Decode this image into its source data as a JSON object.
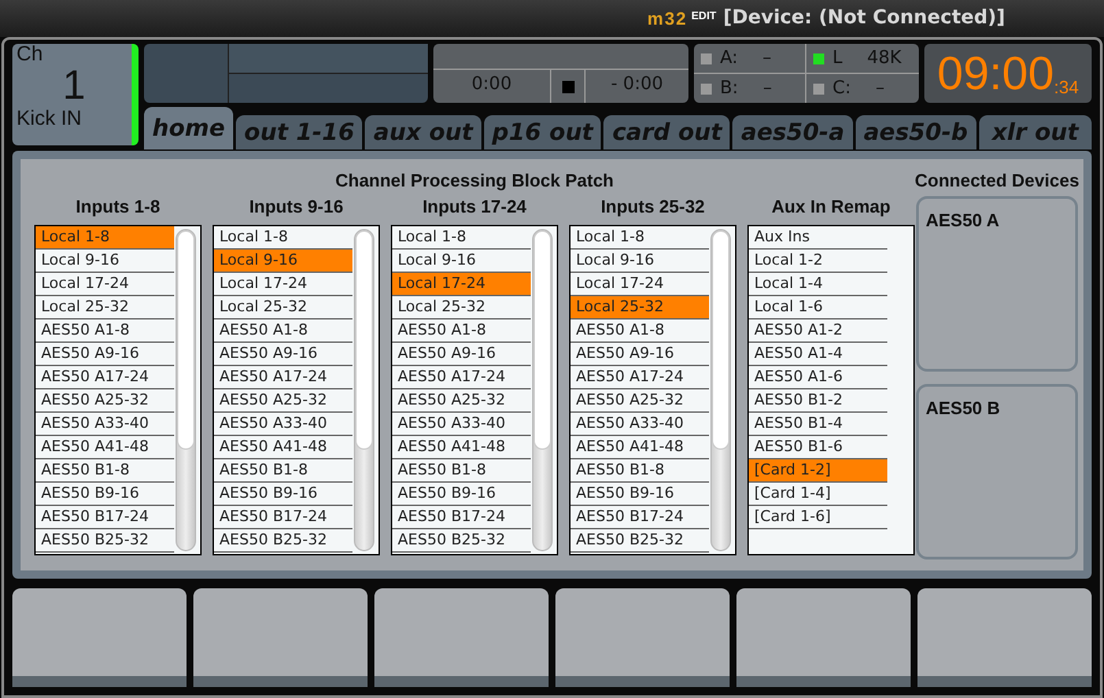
{
  "title_bar": {
    "logo_mark": "m32",
    "logo_word": "EDIT",
    "title": "[Device: (Not Connected)]"
  },
  "channel": {
    "label": "Ch",
    "number": "1",
    "name": "Kick IN"
  },
  "transport": {
    "elapsed": "0:00",
    "remaining": "- 0:00"
  },
  "status": [
    {
      "label": "A:",
      "value": "–",
      "on": false
    },
    {
      "label": "L",
      "value": "48K",
      "on": true
    },
    {
      "label": "B:",
      "value": "–",
      "on": false
    },
    {
      "label": "C:",
      "value": "–",
      "on": false
    }
  ],
  "clock": {
    "time": "09:00",
    "seconds": ":34"
  },
  "tabs": [
    {
      "label": "home",
      "selected": true
    },
    {
      "label": "out 1-16",
      "selected": false
    },
    {
      "label": "aux out",
      "selected": false
    },
    {
      "label": "p16 out",
      "selected": false
    },
    {
      "label": "card out",
      "selected": false
    },
    {
      "label": "aes50-a",
      "selected": false
    },
    {
      "label": "aes50-b",
      "selected": false
    },
    {
      "label": "xlr out",
      "selected": false
    }
  ],
  "patch": {
    "title": "Channel Processing Block Patch",
    "lists": [
      {
        "heading": "Inputs 1-8",
        "scrollbar": true,
        "items": [
          {
            "label": "Local 1-8",
            "selected": true
          },
          {
            "label": "Local 9-16",
            "selected": false
          },
          {
            "label": "Local 17-24",
            "selected": false
          },
          {
            "label": "Local 25-32",
            "selected": false
          },
          {
            "label": "AES50 A1-8",
            "selected": false
          },
          {
            "label": "AES50 A9-16",
            "selected": false
          },
          {
            "label": "AES50 A17-24",
            "selected": false
          },
          {
            "label": "AES50 A25-32",
            "selected": false
          },
          {
            "label": "AES50 A33-40",
            "selected": false
          },
          {
            "label": "AES50 A41-48",
            "selected": false
          },
          {
            "label": "AES50 B1-8",
            "selected": false
          },
          {
            "label": "AES50 B9-16",
            "selected": false
          },
          {
            "label": "AES50 B17-24",
            "selected": false
          },
          {
            "label": "AES50 B25-32",
            "selected": false
          }
        ]
      },
      {
        "heading": "Inputs 9-16",
        "scrollbar": true,
        "items": [
          {
            "label": "Local 1-8",
            "selected": false
          },
          {
            "label": "Local 9-16",
            "selected": true
          },
          {
            "label": "Local 17-24",
            "selected": false
          },
          {
            "label": "Local 25-32",
            "selected": false
          },
          {
            "label": "AES50 A1-8",
            "selected": false
          },
          {
            "label": "AES50 A9-16",
            "selected": false
          },
          {
            "label": "AES50 A17-24",
            "selected": false
          },
          {
            "label": "AES50 A25-32",
            "selected": false
          },
          {
            "label": "AES50 A33-40",
            "selected": false
          },
          {
            "label": "AES50 A41-48",
            "selected": false
          },
          {
            "label": "AES50 B1-8",
            "selected": false
          },
          {
            "label": "AES50 B9-16",
            "selected": false
          },
          {
            "label": "AES50 B17-24",
            "selected": false
          },
          {
            "label": "AES50 B25-32",
            "selected": false
          }
        ]
      },
      {
        "heading": "Inputs 17-24",
        "scrollbar": true,
        "items": [
          {
            "label": "Local 1-8",
            "selected": false
          },
          {
            "label": "Local 9-16",
            "selected": false
          },
          {
            "label": "Local 17-24",
            "selected": true
          },
          {
            "label": "Local 25-32",
            "selected": false
          },
          {
            "label": "AES50 A1-8",
            "selected": false
          },
          {
            "label": "AES50 A9-16",
            "selected": false
          },
          {
            "label": "AES50 A17-24",
            "selected": false
          },
          {
            "label": "AES50 A25-32",
            "selected": false
          },
          {
            "label": "AES50 A33-40",
            "selected": false
          },
          {
            "label": "AES50 A41-48",
            "selected": false
          },
          {
            "label": "AES50 B1-8",
            "selected": false
          },
          {
            "label": "AES50 B9-16",
            "selected": false
          },
          {
            "label": "AES50 B17-24",
            "selected": false
          },
          {
            "label": "AES50 B25-32",
            "selected": false
          }
        ]
      },
      {
        "heading": "Inputs 25-32",
        "scrollbar": true,
        "items": [
          {
            "label": "Local 1-8",
            "selected": false
          },
          {
            "label": "Local 9-16",
            "selected": false
          },
          {
            "label": "Local 17-24",
            "selected": false
          },
          {
            "label": "Local 25-32",
            "selected": true
          },
          {
            "label": "AES50 A1-8",
            "selected": false
          },
          {
            "label": "AES50 A9-16",
            "selected": false
          },
          {
            "label": "AES50 A17-24",
            "selected": false
          },
          {
            "label": "AES50 A25-32",
            "selected": false
          },
          {
            "label": "AES50 A33-40",
            "selected": false
          },
          {
            "label": "AES50 A41-48",
            "selected": false
          },
          {
            "label": "AES50 B1-8",
            "selected": false
          },
          {
            "label": "AES50 B9-16",
            "selected": false
          },
          {
            "label": "AES50 B17-24",
            "selected": false
          },
          {
            "label": "AES50 B25-32",
            "selected": false
          }
        ]
      },
      {
        "heading": "Aux In Remap",
        "scrollbar": false,
        "items": [
          {
            "label": "Aux Ins",
            "selected": false
          },
          {
            "label": "Local 1-2",
            "selected": false
          },
          {
            "label": "Local 1-4",
            "selected": false
          },
          {
            "label": "Local 1-6",
            "selected": false
          },
          {
            "label": "AES50 A1-2",
            "selected": false
          },
          {
            "label": "AES50 A1-4",
            "selected": false
          },
          {
            "label": "AES50 A1-6",
            "selected": false
          },
          {
            "label": "AES50 B1-2",
            "selected": false
          },
          {
            "label": "AES50 B1-4",
            "selected": false
          },
          {
            "label": "AES50 B1-6",
            "selected": false
          },
          {
            "label": "[Card 1-2]",
            "selected": true
          },
          {
            "label": "[Card 1-4]",
            "selected": false
          },
          {
            "label": "[Card 1-6]",
            "selected": false
          }
        ]
      }
    ]
  },
  "connected_devices": {
    "title": "Connected Devices",
    "devices": [
      "AES50 A",
      "AES50 B"
    ]
  }
}
